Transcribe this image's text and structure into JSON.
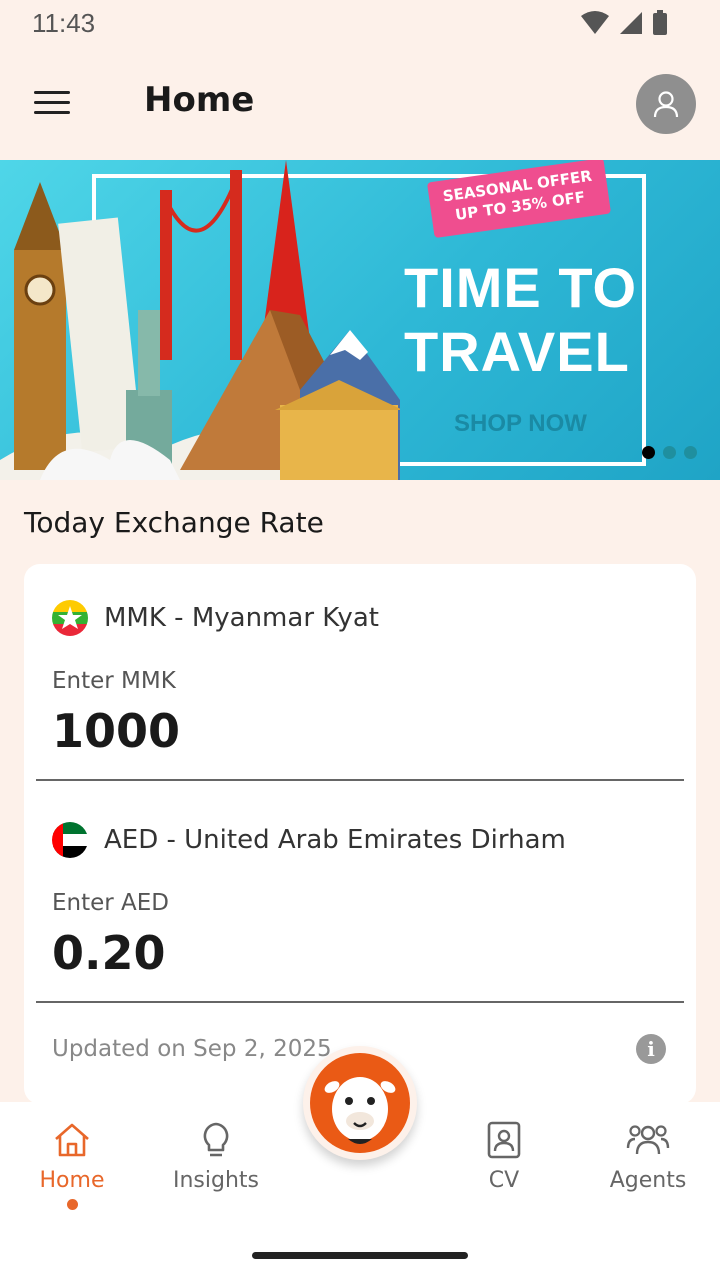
{
  "status_bar": {
    "time": "11:43"
  },
  "app_bar": {
    "title": "Home"
  },
  "banner": {
    "offer_line1": "SEASONAL OFFER",
    "offer_line2": "UP TO 35% OFF",
    "headline_line1": "TIME TO",
    "headline_line2": "TRAVEL",
    "cta": "SHOP NOW",
    "slides": 3,
    "active_slide": 1
  },
  "exchange": {
    "section_title": "Today Exchange Rate",
    "from": {
      "currency": "MMK - Myanmar Kyat",
      "label": "Enter MMK",
      "value": "1000"
    },
    "to": {
      "currency": "AED - United Arab Emirates Dirham",
      "label": "Enter AED",
      "value": "0.20"
    },
    "updated": "Updated on Sep 2, 2025",
    "info_icon": "info-icon"
  },
  "nav": {
    "items": [
      {
        "label": "Home",
        "icon": "home-icon",
        "active": true
      },
      {
        "label": "Insights",
        "icon": "lightbulb-icon",
        "active": false
      },
      {
        "label": "CV",
        "icon": "cv-icon",
        "active": false
      },
      {
        "label": "Agents",
        "icon": "agents-icon",
        "active": false
      }
    ],
    "center_button_icon": "camel-mascot-icon"
  },
  "colors": {
    "accent": "#e8672a",
    "background": "#fdf1ea",
    "banner": "#2eb8d6",
    "fab": "#ea5a15"
  }
}
